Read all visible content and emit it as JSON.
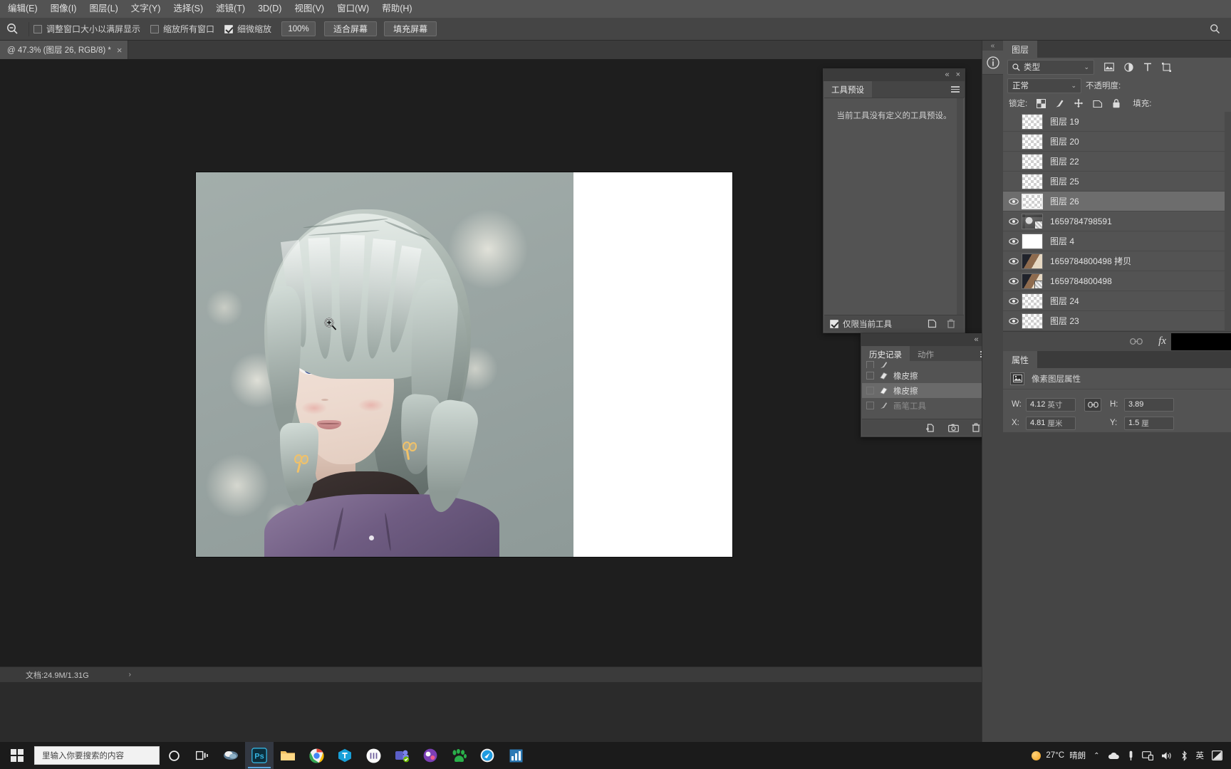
{
  "menubar": {
    "items": [
      {
        "label": "编辑(E)",
        "name": "menu-edit"
      },
      {
        "label": "图像(I)",
        "name": "menu-image"
      },
      {
        "label": "图层(L)",
        "name": "menu-layer"
      },
      {
        "label": "文字(Y)",
        "name": "menu-type"
      },
      {
        "label": "选择(S)",
        "name": "menu-select"
      },
      {
        "label": "滤镜(T)",
        "name": "menu-filter"
      },
      {
        "label": "3D(D)",
        "name": "menu-3d"
      },
      {
        "label": "视图(V)",
        "name": "menu-view"
      },
      {
        "label": "窗口(W)",
        "name": "menu-window"
      },
      {
        "label": "帮助(H)",
        "name": "menu-help"
      }
    ]
  },
  "options": {
    "tool_icon": "zoom-out-icon",
    "resize_window_label": "调整窗口大小以满屏显示",
    "resize_window_checked": false,
    "zoom_all_windows_label": "缩放所有窗口",
    "zoom_all_windows_checked": false,
    "scrubby_zoom_label": "细微缩放",
    "scrubby_zoom_checked": true,
    "zoom_value": "100%",
    "fit_screen_label": "适合屏幕",
    "fill_screen_label": "填充屏幕",
    "search_icon": "search-icon"
  },
  "document_tab": {
    "title": "@ 47.3% (图层 26, RGB/8) *",
    "close_glyph": "×"
  },
  "canvas": {
    "zoom_cursor": "zoom-in-cursor"
  },
  "statusbar": {
    "doc_info": "文档:24.9M/1.31G",
    "arrow": "›"
  },
  "tool_presets": {
    "tab_label": "工具预设",
    "empty_message": "当前工具没有定义的工具预设。",
    "only_current_tool_label": "仅限当前工具",
    "only_current_tool_checked": true,
    "new_icon": "new-preset-icon",
    "delete_icon": "trash-icon",
    "collapse_glyph": "«",
    "close_glyph": "×",
    "menu_icon": "panel-menu-icon"
  },
  "history": {
    "tabs": [
      {
        "label": "历史记录",
        "active": true
      },
      {
        "label": "动作",
        "active": false
      }
    ],
    "rows": [
      {
        "label": "",
        "icon": "brush-icon",
        "selected": false,
        "dim": true,
        "partial": true
      },
      {
        "label": "橡皮擦",
        "icon": "eraser-icon",
        "selected": false,
        "dim": false
      },
      {
        "label": "橡皮擦",
        "icon": "eraser-icon",
        "selected": true,
        "dim": false
      },
      {
        "label": "画笔工具",
        "icon": "brush-icon",
        "selected": false,
        "dim": true
      }
    ],
    "footer_icons": [
      "new-document-icon",
      "camera-icon",
      "trash-icon"
    ],
    "collapse_glyph": "«",
    "close_glyph": "×",
    "menu_icon": "panel-menu-icon"
  },
  "right_rail": {
    "collapse_glyph": "«",
    "icons": [
      {
        "name": "info-icon"
      }
    ]
  },
  "layers_panel": {
    "tab_label": "图层",
    "filter": {
      "search_icon": "search-icon",
      "type_label": "类型",
      "chevron": "⌄",
      "icons": [
        "pixel-filter-icon",
        "adjustment-filter-icon",
        "type-filter-icon",
        "shape-filter-icon",
        "smart-filter-icon"
      ]
    },
    "blend_mode": "正常",
    "opacity_label": "不透明度:",
    "lock_label": "锁定:",
    "lock_icons": [
      "lock-transparency-icon",
      "lock-image-icon",
      "lock-position-icon",
      "lock-artboard-icon",
      "lock-all-icon"
    ],
    "fill_label": "填充:",
    "layers": [
      {
        "name": "图层 19",
        "visible": false,
        "thumb": "transparent",
        "active": false
      },
      {
        "name": "图层 20",
        "visible": false,
        "thumb": "transparent",
        "active": false
      },
      {
        "name": "图层 22",
        "visible": false,
        "thumb": "transparent",
        "active": false
      },
      {
        "name": "图层 25",
        "visible": false,
        "thumb": "transparent",
        "active": false
      },
      {
        "name": "图层 26",
        "visible": true,
        "thumb": "transparent-selected",
        "active": true
      },
      {
        "name": "1659784798591",
        "visible": true,
        "thumb": "photo-portrait",
        "active": false
      },
      {
        "name": "图层 4",
        "visible": true,
        "thumb": "white",
        "active": false
      },
      {
        "name": "1659784800498 拷贝",
        "visible": true,
        "thumb": "photo-color",
        "active": false
      },
      {
        "name": "1659784800498",
        "visible": true,
        "thumb": "photo-color",
        "active": false
      },
      {
        "name": "图层 24",
        "visible": true,
        "thumb": "transparent",
        "active": false
      },
      {
        "name": "图层 23",
        "visible": true,
        "thumb": "transparent",
        "active": false
      }
    ],
    "footer_icons": [
      "link-layers-icon",
      "fx-icon",
      "mask-icon",
      "adjustment-icon",
      "group-icon",
      "new-layer-icon",
      "delete-layer-icon"
    ],
    "fx_label": "fx"
  },
  "properties_panel": {
    "tab_label": "属性",
    "header_icon": "pixel-layer-icon",
    "header_label": "像素图层属性",
    "fields": [
      {
        "label": "W:",
        "value": "4.12",
        "unit": "英寸",
        "name": "width-field"
      },
      {
        "label": "H:",
        "value": "3.89",
        "unit": "",
        "name": "height-field"
      },
      {
        "label": "X:",
        "value": "4.81",
        "unit": "厘米",
        "name": "x-field"
      },
      {
        "label": "Y:",
        "value": "1.5",
        "unit": "厘",
        "name": "y-field"
      }
    ],
    "link_icon": "link-icon"
  },
  "taskbar": {
    "start_icon": "windows-start-icon",
    "search_placeholder": "里输入你要搜索的内容",
    "icons": [
      {
        "name": "cortana-icon"
      },
      {
        "name": "task-view-icon"
      },
      {
        "name": "mail-app-icon"
      },
      {
        "name": "photoshop-icon",
        "active": true
      },
      {
        "name": "file-explorer-icon"
      },
      {
        "name": "chrome-icon"
      },
      {
        "name": "tencent-docs-icon"
      },
      {
        "name": "app-circle-icon"
      },
      {
        "name": "teams-icon"
      },
      {
        "name": "app-purple-icon"
      },
      {
        "name": "baidu-icon"
      },
      {
        "name": "qq-browser-icon"
      },
      {
        "name": "chart-app-icon"
      }
    ],
    "tray": {
      "weather_icon": "sun-icon",
      "temperature": "27°C",
      "condition": "晴朗",
      "chevron": "⌃",
      "icons": [
        "cloud-icon",
        "battery-icon",
        "display-icon",
        "volume-icon",
        "bluetooth-icon"
      ],
      "ime": "英",
      "notification_icon": "notification-icon"
    }
  },
  "colors": {
    "window_bg": "#535353",
    "canvas_bg": "#1e1e1e",
    "panel_bg": "#454545",
    "accent": "#5aa8e0",
    "taskbar_bg": "#1b1b1b"
  }
}
